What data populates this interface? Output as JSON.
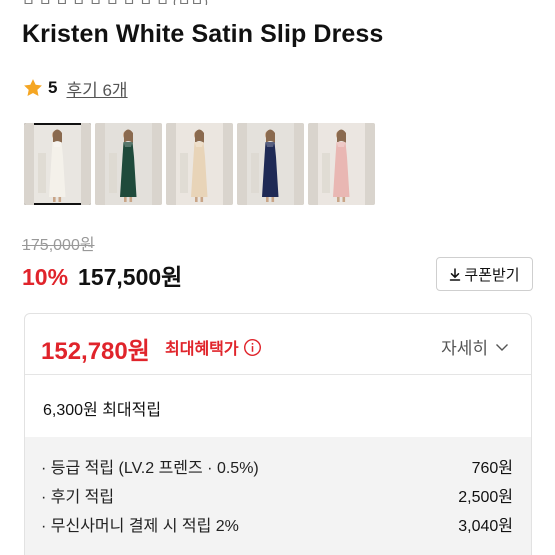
{
  "product": {
    "title": "Kristen White Satin Slip Dress",
    "rating": {
      "score": "5",
      "reviews_label": "후기 6개"
    },
    "thumbnails": [
      {
        "name": "white",
        "color": "#f4f1ea",
        "bg": "#e9e6e1",
        "selected": true
      },
      {
        "name": "green",
        "color": "#1f4a3b",
        "bg": "#e3e0db",
        "selected": false
      },
      {
        "name": "champagne",
        "color": "#e8d4b8",
        "bg": "#ebe6e0",
        "selected": false
      },
      {
        "name": "navy",
        "color": "#1f2a55",
        "bg": "#e4e1dc",
        "selected": false
      },
      {
        "name": "pink",
        "color": "#e9b7b3",
        "bg": "#ebe6e1",
        "selected": false
      }
    ],
    "original_price": "175,000원",
    "discount": "10%",
    "sale_price": "157,500원",
    "coupon_label": "쿠폰받기"
  },
  "benefits": {
    "best_price": "152,780원",
    "best_label": "최대혜택가",
    "detail_label": "자세히",
    "points_total": "6,300원 최대적립",
    "points": [
      {
        "label": "· 등급 적립 (LV.2 프렌즈 · 0.5%)",
        "amount": "760원"
      },
      {
        "label": "· 후기 적립",
        "amount": "2,500원"
      },
      {
        "label": "· 무신사머니 결제 시 적립 2%",
        "amount": "3,040원"
      }
    ]
  },
  "colors": {
    "accent_red": "#e0242b",
    "star": "#f5a623"
  }
}
